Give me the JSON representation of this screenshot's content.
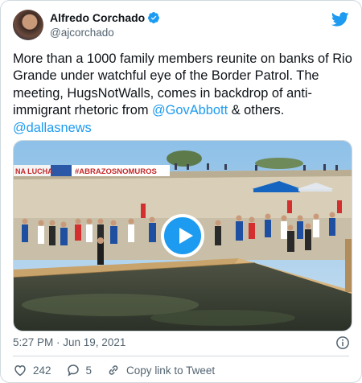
{
  "author": {
    "display_name": "Alfredo Corchado",
    "handle": "@ajcorchado"
  },
  "tweet": {
    "text_part1": "More than a 1000 family members reunite on banks of Rio Grande under watchful eye of the Border Patrol. The meeting, HugsNotWalls, comes in backdrop of anti-immigrant rhetoric from ",
    "mention1": "@GovAbbott",
    "text_part2": " & others.",
    "mention2": "@dallasnews"
  },
  "media": {
    "banner_left": "NA LUCHA",
    "banner_hashtag": "#ABRAZOSNOMUROS"
  },
  "meta": {
    "timestamp": "5:27 PM · Jun 19, 2021"
  },
  "actions": {
    "like_count": "242",
    "reply_count": "5",
    "copy_link_label": "Copy link to Tweet"
  },
  "colors": {
    "accent": "#1d9bf0",
    "text": "#0f1419",
    "muted": "#536471",
    "border": "#cfd9de"
  },
  "icons": {
    "brand": "twitter-bird-icon",
    "verified": "verified-badge-icon",
    "play": "play-icon",
    "info": "info-icon",
    "like": "heart-icon",
    "reply": "reply-bubble-icon",
    "link": "link-icon"
  }
}
